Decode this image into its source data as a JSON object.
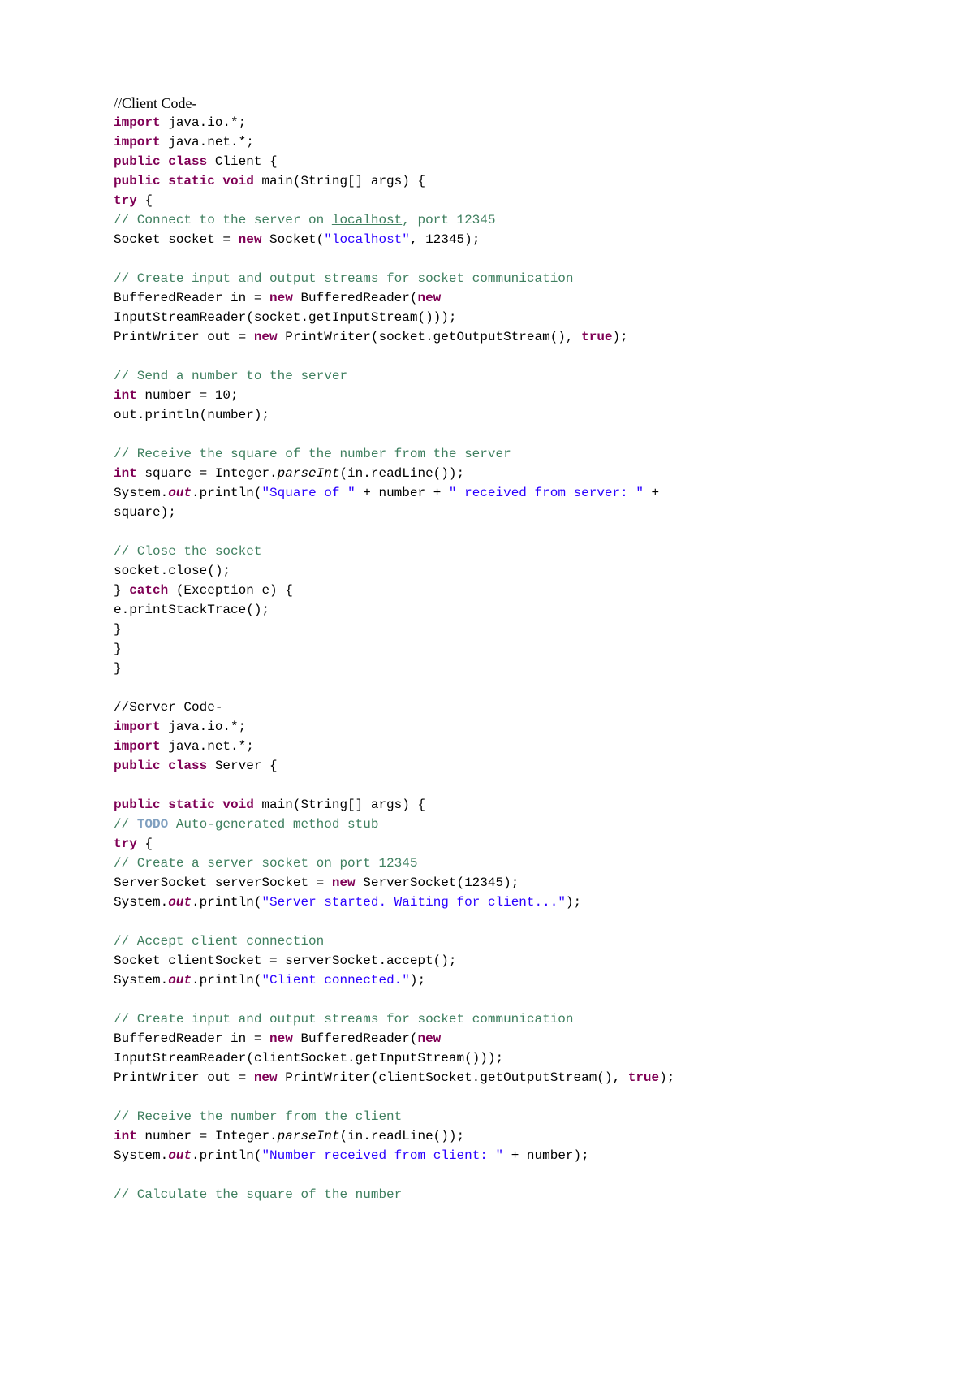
{
  "t": {
    "h1": "//Client Code-",
    "l01a": "import",
    "l01b": " java.io.*;",
    "l02a": "import",
    "l02b": " java.net.*;",
    "l03a": "public class",
    "l03b": " Client {",
    "l04a": "public static void",
    "l04b": " main(String[] args) {",
    "l05a": "try",
    "l05b": " {",
    "l06a": "// Connect to the server on ",
    "l06b": "localhost",
    "l06c": ", port 12345",
    "l07a": "Socket socket = ",
    "l07b": "new",
    "l07c": " Socket(",
    "l07d": "\"localhost\"",
    "l07e": ", 12345);",
    "l08a": "// Create input and output streams for socket communication",
    "l09a": "BufferedReader in = ",
    "l09b": "new",
    "l09c": " BufferedReader(",
    "l09d": "new",
    "l10a": "InputStreamReader(socket.getInputStream()));",
    "l11a": "PrintWriter out = ",
    "l11b": "new",
    "l11c": " PrintWriter(socket.getOutputStream(), ",
    "l11d": "true",
    "l11e": ");",
    "l12a": "// Send a number to the server",
    "l13a": "int",
    "l13b": " number = 10;",
    "l14a": "out.println(number);",
    "l15a": "// Receive the square of the number from the server",
    "l16a": "int",
    "l16b": " square = Integer.",
    "l16c": "parseInt",
    "l16d": "(in.readLine());",
    "l17a": "System.",
    "l17b": "out",
    "l17c": ".println(",
    "l17d": "\"Square of \"",
    "l17e": " + number + ",
    "l17f": "\" received from server: \"",
    "l17g": " +",
    "l18a": "square);",
    "l19a": "// Close the socket",
    "l20a": "socket.close();",
    "l21a": "} ",
    "l21b": "catch",
    "l21c": " (Exception e) {",
    "l22a": "e.printStackTrace();",
    "l23a": "}",
    "l24a": "}",
    "l25a": "}",
    "h2": "//Server Code-",
    "s01a": "import",
    "s01b": " java.io.*;",
    "s02a": "import",
    "s02b": " java.net.*;",
    "s03a": "public class",
    "s03b": " Server {",
    "s04a": "public static void",
    "s04b": " main(String[] args) {",
    "s05a": "// ",
    "s05b": "TODO",
    "s05c": " Auto-generated method stub",
    "s06a": "try",
    "s06b": " {",
    "s07a": "// Create a server socket on port 12345",
    "s08a": "ServerSocket serverSocket = ",
    "s08b": "new",
    "s08c": " ServerSocket(12345);",
    "s09a": "System.",
    "s09b": "out",
    "s09c": ".println(",
    "s09d": "\"Server started. Waiting for client...\"",
    "s09e": ");",
    "s10a": "// Accept client connection",
    "s11a": "Socket clientSocket = serverSocket.accept();",
    "s12a": "System.",
    "s12b": "out",
    "s12c": ".println(",
    "s12d": "\"Client connected.\"",
    "s12e": ");",
    "s13a": "// Create input and output streams for socket communication",
    "s14a": "BufferedReader in = ",
    "s14b": "new",
    "s14c": " BufferedReader(",
    "s14d": "new",
    "s15a": "InputStreamReader(clientSocket.getInputStream()));",
    "s16a": "PrintWriter out = ",
    "s16b": "new",
    "s16c": " PrintWriter(clientSocket.getOutputStream(), ",
    "s16d": "true",
    "s16e": ");",
    "s17a": "// Receive the number from the client",
    "s18a": "int",
    "s18b": " number = Integer.",
    "s18c": "parseInt",
    "s18d": "(in.readLine());",
    "s19a": "System.",
    "s19b": "out",
    "s19c": ".println(",
    "s19d": "\"Number received from client: \"",
    "s19e": " + number);",
    "s20a": "// Calculate the square of the number"
  }
}
